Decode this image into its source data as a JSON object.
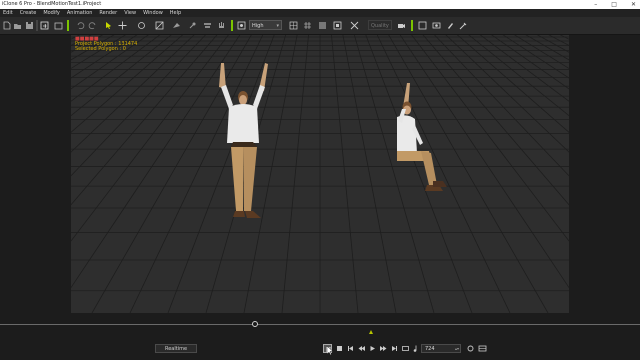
{
  "window": {
    "title": "iClone 6 Pro - BlendMotionTest1.iProject",
    "controls": [
      "minimize",
      "maximize",
      "close"
    ]
  },
  "menu": [
    "Edit",
    "Create",
    "Modify",
    "Animation",
    "Render",
    "View",
    "Window",
    "Help"
  ],
  "toolbar": {
    "render_quality": "High",
    "quality_field": "Quality",
    "accent_color": "#7cc400"
  },
  "viewport": {
    "info_line_1": "Project Polygon : 131474",
    "info_line_2": "Selected Polygon : 0",
    "background": "#2e2e2e",
    "grid_color": "#1e1e1e"
  },
  "timeline": {
    "realtime_label": "Realtime",
    "current_frame": "724",
    "position": 0.4
  },
  "playback_icons": [
    "pause-icon",
    "stop-icon",
    "to-start-icon",
    "prev-frame-icon",
    "play-icon",
    "next-frame-icon",
    "to-end-icon",
    "loop-icon",
    "range-icon",
    "music-icon"
  ]
}
